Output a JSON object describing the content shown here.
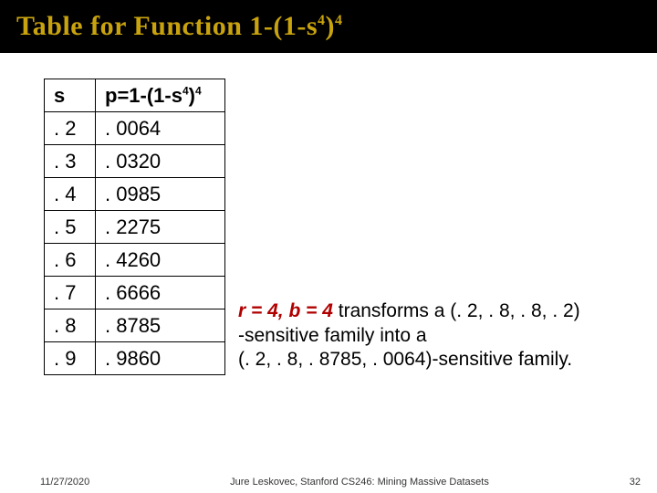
{
  "title": {
    "prefix": "Table for Function 1-(1-s",
    "sup1": "4",
    "mid": ")",
    "sup2": "4"
  },
  "table": {
    "header_s": "s",
    "header_p_prefix": "p=1-(1-s",
    "header_p_sup1": "4",
    "header_p_mid": ")",
    "header_p_sup2": "4",
    "rows": [
      {
        "s": ". 2",
        "p": ". 0064"
      },
      {
        "s": ". 3",
        "p": ". 0320"
      },
      {
        "s": ". 4",
        "p": ". 0985"
      },
      {
        "s": ". 5",
        "p": ". 2275"
      },
      {
        "s": ". 6",
        "p": ". 4260"
      },
      {
        "s": ". 7",
        "p": ". 6666"
      },
      {
        "s": ". 8",
        "p": ". 8785"
      },
      {
        "s": ". 9",
        "p": ". 9860"
      }
    ]
  },
  "caption": {
    "bold": "r = 4, b = 4",
    "line1_rest": "  transforms a (. 2, . 8, . 8, . 2)",
    "line2": "-sensitive family into a",
    "line3": "(. 2, . 8, . 8785, . 0064)-sensitive family."
  },
  "footer": {
    "date": "11/27/2020",
    "credit": "Jure Leskovec, Stanford CS246: Mining Massive Datasets",
    "pagenum": "32"
  }
}
